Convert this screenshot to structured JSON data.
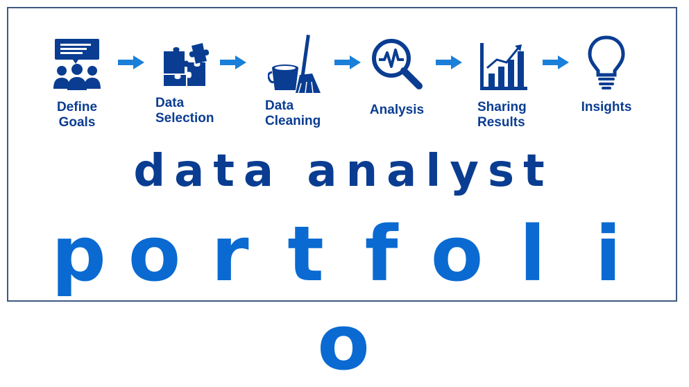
{
  "steps": [
    {
      "icon": "presentation-team-icon",
      "label_line1": "Define",
      "label_line2": "Goals"
    },
    {
      "icon": "puzzle-pieces-icon",
      "label_line1": "Data",
      "label_line2": "Selection"
    },
    {
      "icon": "bucket-broom-icon",
      "label_line1": "Data",
      "label_line2": "Cleaning"
    },
    {
      "icon": "magnifier-pulse-icon",
      "label_line1": "Analysis",
      "label_line2": ""
    },
    {
      "icon": "bar-chart-growth-icon",
      "label_line1": "Sharing",
      "label_line2": "Results"
    },
    {
      "icon": "lightbulb-icon",
      "label_line1": "Insights",
      "label_line2": ""
    }
  ],
  "headline": "data analyst",
  "subheadline": "portfolio",
  "colors": {
    "dark_blue": "#0a3d91",
    "bright_blue": "#0a6ad1",
    "arrow_blue": "#1a7fd8",
    "border": "#3d5a80"
  }
}
